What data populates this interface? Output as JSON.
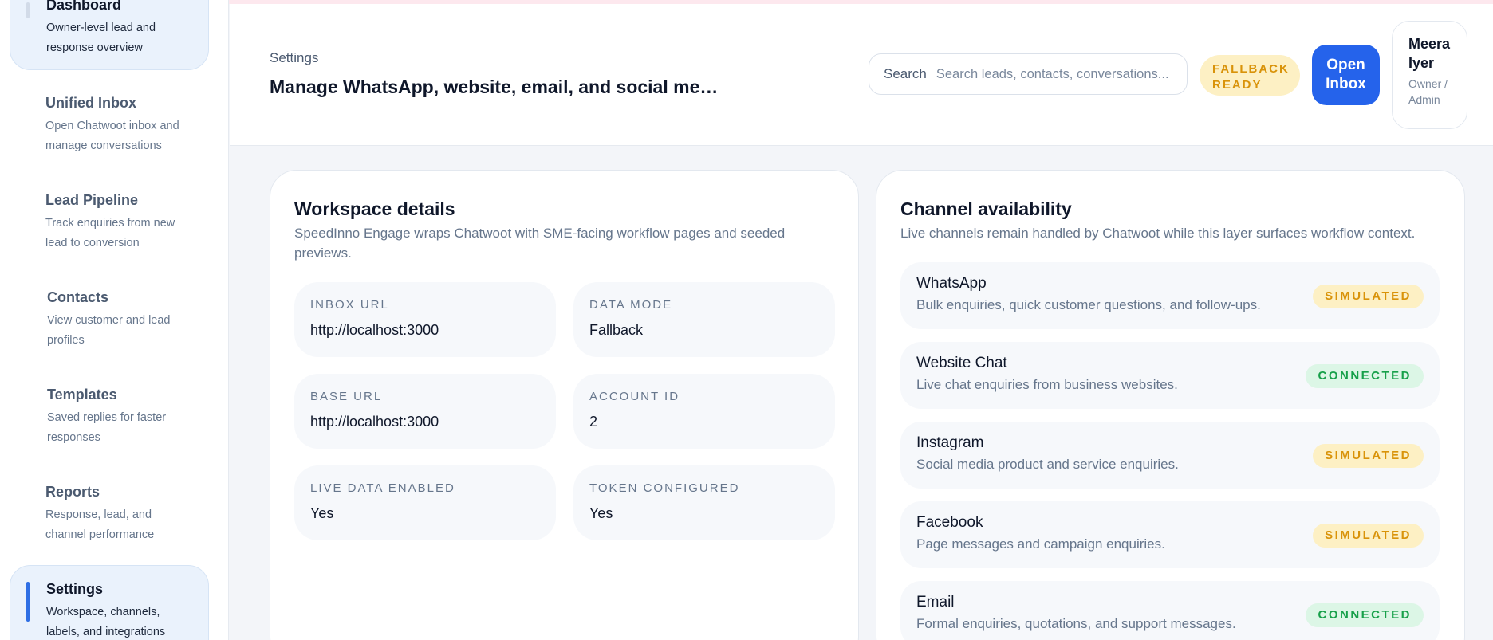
{
  "sidebar": {
    "items": [
      {
        "label": "Dashboard",
        "desc": "Owner-level lead and response overview"
      },
      {
        "label": "Unified Inbox",
        "desc": "Open Chatwoot inbox and manage conversations"
      },
      {
        "label": "Lead Pipeline",
        "desc": "Track enquiries from new lead to conversion"
      },
      {
        "label": "Contacts",
        "desc": "View customer and lead profiles"
      },
      {
        "label": "Templates",
        "desc": "Saved replies for faster responses"
      },
      {
        "label": "Reports",
        "desc": "Response, lead, and channel performance"
      },
      {
        "label": "Settings",
        "desc": "Workspace, channels, labels, and integrations"
      }
    ]
  },
  "header": {
    "breadcrumb": "Settings",
    "title": "Manage WhatsApp, website, email, and social media enquiries from one place",
    "search_label": "Search",
    "search_placeholder": "Search leads, contacts, conversations...",
    "fallback_badge": "FALLBACK READY",
    "open_inbox": "Open Inbox",
    "user_name": "Meera Iyer",
    "user_role": "Owner / Admin"
  },
  "workspace": {
    "title": "Workspace details",
    "subtitle": "SpeedInno Engage wraps Chatwoot with SME-facing workflow pages and seeded previews.",
    "fields": [
      {
        "label": "INBOX URL",
        "value": "http://localhost:3000"
      },
      {
        "label": "DATA MODE",
        "value": "Fallback"
      },
      {
        "label": "BASE URL",
        "value": "http://localhost:3000"
      },
      {
        "label": "ACCOUNT ID",
        "value": "2"
      },
      {
        "label": "LIVE DATA ENABLED",
        "value": "Yes"
      },
      {
        "label": "TOKEN CONFIGURED",
        "value": "Yes"
      }
    ]
  },
  "channels": {
    "title": "Channel availability",
    "subtitle": "Live channels remain handled by Chatwoot while this layer surfaces workflow context.",
    "items": [
      {
        "name": "WhatsApp",
        "desc": "Bulk enquiries, quick customer questions, and follow-ups.",
        "status": "SIMULATED"
      },
      {
        "name": "Website Chat",
        "desc": "Live chat enquiries from business websites.",
        "status": "CONNECTED"
      },
      {
        "name": "Instagram",
        "desc": "Social media product and service enquiries.",
        "status": "SIMULATED"
      },
      {
        "name": "Facebook",
        "desc": "Page messages and campaign enquiries.",
        "status": "SIMULATED"
      },
      {
        "name": "Email",
        "desc": "Formal enquiries, quotations, and support messages.",
        "status": "CONNECTED"
      }
    ]
  },
  "colors": {
    "accent": "#2563eb",
    "simulated_bg": "#fdf0c4",
    "simulated_text": "#d9930a",
    "connected_bg": "#dcf6e6",
    "connected_text": "#17a04a"
  }
}
